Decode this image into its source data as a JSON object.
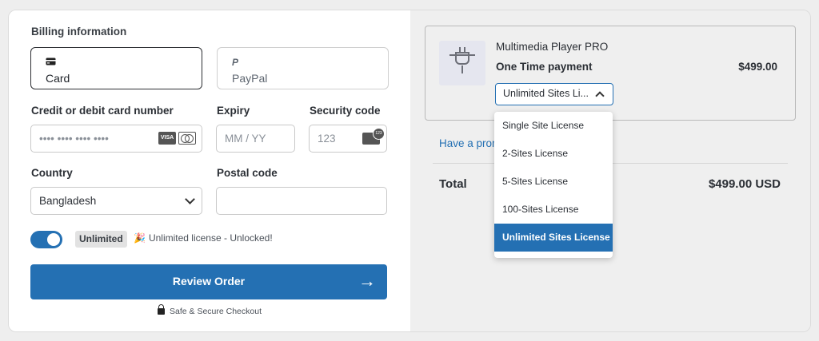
{
  "billing": {
    "title": "Billing information",
    "methods": [
      {
        "icon": "credit-card-icon",
        "label": "Card"
      },
      {
        "icon": "paypal-icon",
        "label": "PayPal"
      }
    ]
  },
  "form": {
    "card_label": "Credit or debit card number",
    "card_value": "•••• •••• •••• ••••",
    "card_brands": [
      "VISA",
      "Mastercard"
    ],
    "expiry_label": "Expiry",
    "expiry_placeholder": "MM / YY",
    "cvc_label": "Security code",
    "cvc_placeholder": "123",
    "country_label": "Country",
    "country_value": "Bangladesh",
    "postal_label": "Postal code",
    "postal_value": ""
  },
  "license_toggle": {
    "on": true,
    "badge": "Unlimited",
    "message": "Unlimited license - Unlocked!",
    "emoji": "🎉"
  },
  "actions": {
    "review_label": "Review Order",
    "secure_label": "Safe & Secure Checkout"
  },
  "summary": {
    "product_name": "Multimedia Player PRO",
    "payment_type": "One Time payment",
    "price": "$499.00",
    "license_selected": "Unlimited Sites Li...",
    "promo_text": "Have a prom",
    "total_label": "Total",
    "total_amount": "$499.00  USD"
  },
  "license_options": [
    "Single Site License",
    "2-Sites License",
    "5-Sites License",
    "100-Sites License",
    "Unlimited Sites License"
  ],
  "colors": {
    "accent": "#2470b3",
    "panel_bg": "#efefef"
  }
}
